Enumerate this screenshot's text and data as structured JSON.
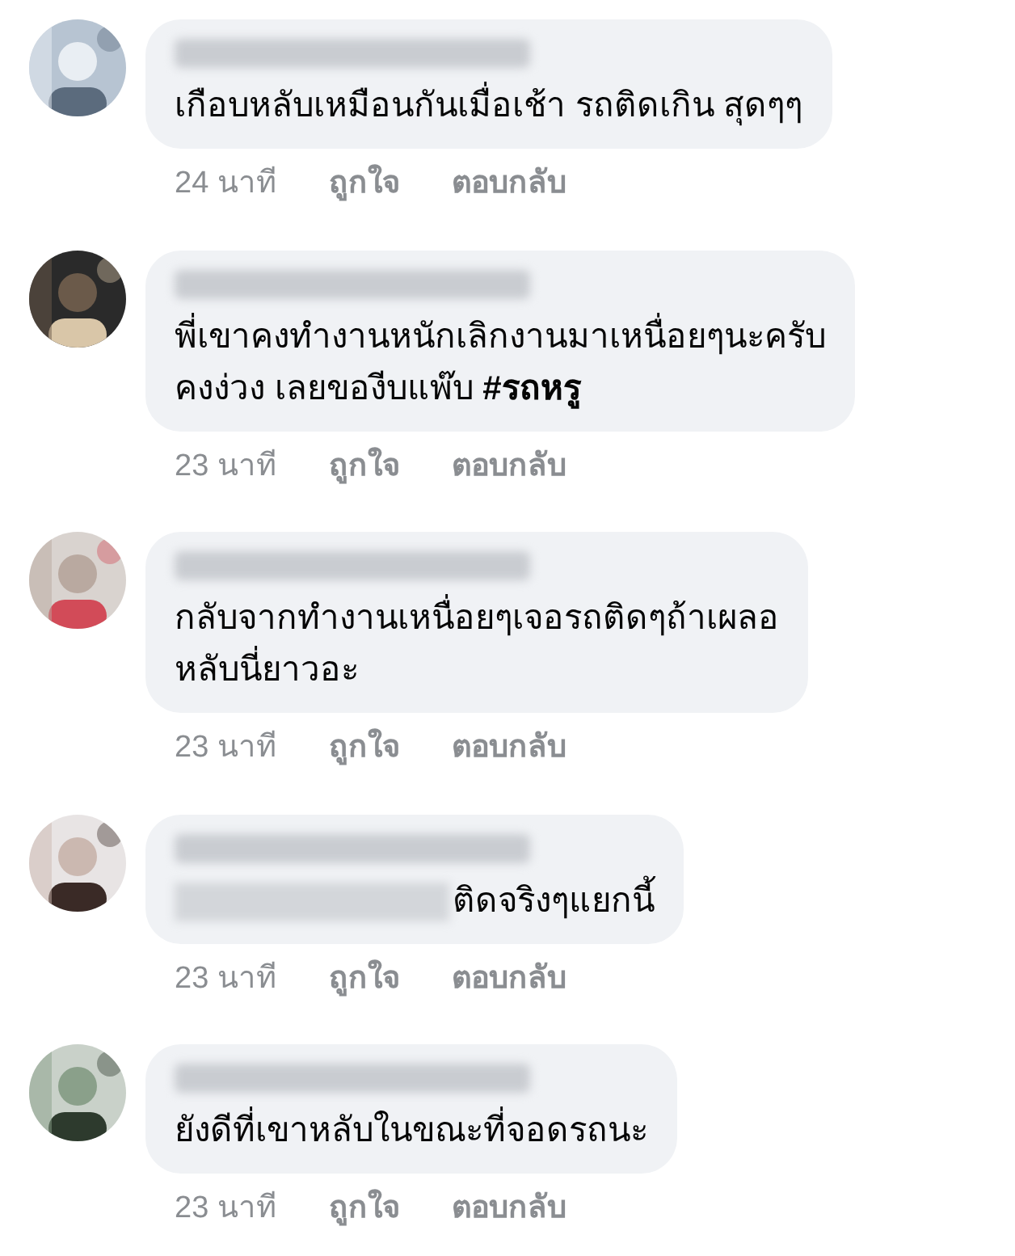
{
  "comments": [
    {
      "lines": [
        "เกือบหลับเหมือนกันเมื่อเช้า รถติดเกิน สุดๆๆ"
      ],
      "time": "24 นาที",
      "like": "ถูกใจ",
      "reply": "ตอบกลับ",
      "mention": false
    },
    {
      "lines": [
        "พี่เขาคงทำงานหนักเลิกงานมาเหนื่อยๆนะครับ",
        "คงง่วง เลยของีบแพ๊บ  **#รถหรู**"
      ],
      "time": "23 นาที",
      "like": "ถูกใจ",
      "reply": "ตอบกลับ",
      "mention": false
    },
    {
      "lines": [
        "กลับจากทำงานเหนื่อยๆเจอรถติดๆถ้าเผลอ",
        "หลับนี่ยาวอะ"
      ],
      "time": "23 นาที",
      "like": "ถูกใจ",
      "reply": "ตอบกลับ",
      "mention": false
    },
    {
      "lines": [
        "ติดจริงๆแยกนี้"
      ],
      "time": "23 นาที",
      "like": "ถูกใจ",
      "reply": "ตอบกลับ",
      "mention": true
    },
    {
      "lines": [
        "ยังดีที่เขาหลับในขณะที่จอดรถนะ"
      ],
      "time": "23 นาที",
      "like": "ถูกใจ",
      "reply": "ตอบกลับ",
      "mention": false
    }
  ]
}
